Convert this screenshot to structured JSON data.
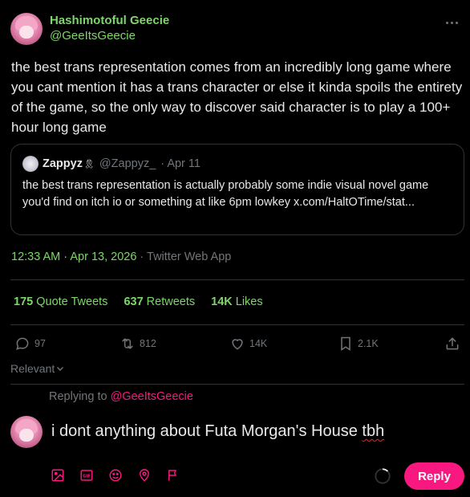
{
  "author": {
    "display_name": "Hashimotoful Geecie",
    "handle": "@GeeItsGeecie"
  },
  "tweet": {
    "text": "the best trans representation comes from an incredibly long game where you cant mention it has a trans character or else it kinda spoils the entirety of the game, so the only way to discover said character is to play a 100+ hour long game",
    "timestamp": "12:33 AM · Apr 13, 2026",
    "source": " · Twitter Web App"
  },
  "quote": {
    "display_name": "Zappyz",
    "badge": "🎗",
    "handle": "@Zappyz_",
    "date": "· Apr 11",
    "text": "the best trans representation is actually probably some indie visual novel game you'd find on itch io or something at like 6pm lowkey x.com/HaltOTime/stat..."
  },
  "stats": {
    "quote_tweets_count": "175",
    "quote_tweets_label": "Quote Tweets",
    "retweets_count": "637",
    "retweets_label": "Retweets",
    "likes_count": "14K",
    "likes_label": "Likes"
  },
  "actions": {
    "replies": "97",
    "retweets": "812",
    "likes": "14K",
    "bookmarks": "2.1K"
  },
  "sort": {
    "label": "Relevant"
  },
  "reply": {
    "replying_prefix": "Replying to ",
    "replying_mention": "@GeeItsGeecie",
    "text_before": "i dont anything about Futa Morgan's House ",
    "text_misspelled": "tbh",
    "button_label": "Reply"
  },
  "colors": {
    "accent_green": "#7ed66b",
    "accent_pink": "#f91880",
    "muted": "#71767b",
    "border": "#2f3336",
    "background": "#000000"
  }
}
